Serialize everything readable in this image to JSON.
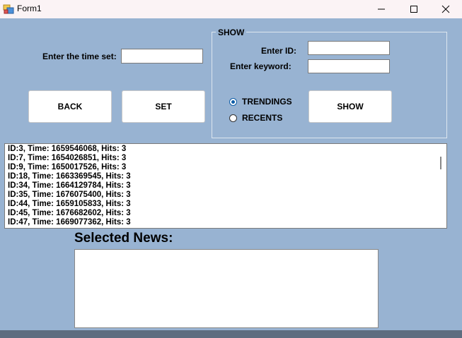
{
  "window": {
    "title": "Form1",
    "controls": [
      "minimize-icon",
      "maximize-icon",
      "close-icon"
    ]
  },
  "time_set": {
    "label": "Enter the time set:",
    "value": ""
  },
  "buttons": {
    "back": "BACK",
    "set": "SET",
    "show": "SHOW"
  },
  "show_group": {
    "title": "SHOW",
    "id_label": "Enter ID:",
    "id_value": "",
    "keyword_label": "Enter keyword:",
    "keyword_value": "",
    "radios": [
      {
        "label": "TRENDINGS",
        "checked": true
      },
      {
        "label": "RECENTS",
        "checked": false
      }
    ]
  },
  "news_list": {
    "items": [
      "ID:3, Time: 1659546068, Hits: 3",
      "ID:7, Time: 1654026851, Hits: 3",
      "ID:9, Time: 1650017526, Hits: 3",
      "ID:18, Time: 1663369545, Hits: 3",
      "ID:34, Time: 1664129784, Hits: 3",
      "ID:35, Time: 1676075400, Hits: 3",
      "ID:44, Time: 1659105833, Hits: 3",
      "ID:45, Time: 1676682602, Hits: 3",
      "ID:47, Time: 1669077362, Hits: 3"
    ]
  },
  "selected_news": {
    "heading": "Selected News:",
    "content": ""
  },
  "colors": {
    "form_background": "#98b3d2",
    "titlebar": "#fbf3f5",
    "radio_accent": "#0f5ea8"
  }
}
